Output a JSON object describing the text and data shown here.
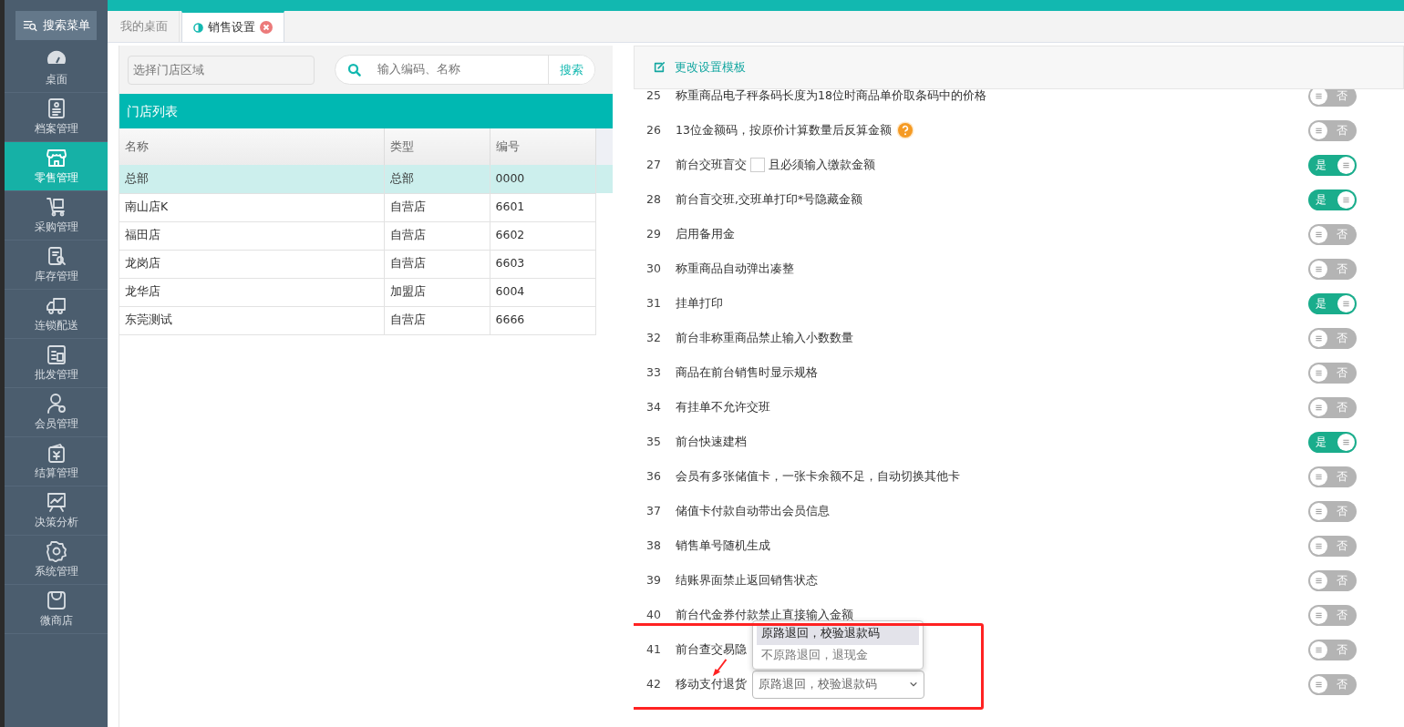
{
  "sidebar": {
    "search_button": "搜索菜单",
    "items": [
      {
        "label": "桌面",
        "kind": "gauge",
        "selected": false
      },
      {
        "label": "档案管理",
        "kind": "document",
        "selected": false
      },
      {
        "label": "零售管理",
        "kind": "store",
        "selected": true
      },
      {
        "label": "采购管理",
        "kind": "cart",
        "selected": false
      },
      {
        "label": "库存管理",
        "kind": "search-doc",
        "selected": false
      },
      {
        "label": "连锁配送",
        "kind": "truck",
        "selected": false
      },
      {
        "label": "批发管理",
        "kind": "clipboard",
        "selected": false
      },
      {
        "label": "会员管理",
        "kind": "user",
        "selected": false
      },
      {
        "label": "结算管理",
        "kind": "wallet",
        "selected": false
      },
      {
        "label": "决策分析",
        "kind": "chart",
        "selected": false
      },
      {
        "label": "系统管理",
        "kind": "gear",
        "selected": false
      },
      {
        "label": "微商店",
        "kind": "bag",
        "selected": false
      }
    ]
  },
  "tabs": [
    {
      "label": "我的桌面",
      "selected": false,
      "closable": false
    },
    {
      "label": "销售设置",
      "selected": true,
      "closable": true
    }
  ],
  "store_panel": {
    "region_placeholder": "选择门店区域",
    "search_placeholder": "输入编码、名称",
    "search_button": "搜索",
    "title": "门店列表",
    "table": {
      "columns": [
        "名称",
        "类型",
        "编号"
      ],
      "rows": [
        {
          "cells": [
            "总部",
            "总部",
            "0000"
          ],
          "selected": true
        },
        {
          "cells": [
            "南山店K",
            "自营店",
            "6601"
          ],
          "selected": false
        },
        {
          "cells": [
            "福田店",
            "自营店",
            "6602"
          ],
          "selected": false
        },
        {
          "cells": [
            "龙岗店",
            "自营店",
            "6603"
          ],
          "selected": false
        },
        {
          "cells": [
            "龙华店",
            "加盟店",
            "6004"
          ],
          "selected": false
        },
        {
          "cells": [
            "东莞测试",
            "自营店",
            "6666"
          ],
          "selected": false
        }
      ]
    }
  },
  "settings": {
    "template_link": "更改设置模板",
    "rows": [
      {
        "number": "25",
        "label": "称重商品电子秤条码长度为18位时商品单价取条码中的价格",
        "on": false,
        "toggle_label": "否"
      },
      {
        "number": "26",
        "label": "13位金额码，按原价计算数量后反算金额",
        "help": true,
        "on": false,
        "toggle_label": "否"
      },
      {
        "number": "27",
        "label": "前台交班盲交",
        "checkbox": {
          "label": "且必须输入缴款金额",
          "checked": false
        },
        "on": true,
        "toggle_label": "是"
      },
      {
        "number": "28",
        "label": "前台盲交班,交班单打印*号隐藏金额",
        "on": true,
        "toggle_label": "是"
      },
      {
        "number": "29",
        "label": "启用备用金",
        "on": false,
        "toggle_label": "否"
      },
      {
        "number": "30",
        "label": "称重商品自动弹出凑整",
        "on": false,
        "toggle_label": "否"
      },
      {
        "number": "31",
        "label": "挂单打印",
        "on": true,
        "toggle_label": "是"
      },
      {
        "number": "32",
        "label": "前台非称重商品禁止输入小数数量",
        "on": false,
        "toggle_label": "否"
      },
      {
        "number": "33",
        "label": "商品在前台销售时显示规格",
        "on": false,
        "toggle_label": "否"
      },
      {
        "number": "34",
        "label": "有挂单不允许交班",
        "on": false,
        "toggle_label": "否"
      },
      {
        "number": "35",
        "label": "前台快速建档",
        "on": true,
        "toggle_label": "是"
      },
      {
        "number": "36",
        "label": "会员有多张储值卡，一张卡余额不足，自动切换其他卡",
        "on": false,
        "toggle_label": "否"
      },
      {
        "number": "37",
        "label": "储值卡付款自动带出会员信息",
        "on": false,
        "toggle_label": "否"
      },
      {
        "number": "38",
        "label": "销售单号随机生成",
        "on": false,
        "toggle_label": "否"
      },
      {
        "number": "39",
        "label": "结账界面禁止返回销售状态",
        "on": false,
        "toggle_label": "否"
      },
      {
        "number": "40",
        "label": "前台代金券付款禁止直接输入金额",
        "on": false,
        "toggle_label": "否"
      },
      {
        "number": "41",
        "label": "前台查交易隐",
        "on": false,
        "toggle_label": "否"
      },
      {
        "number": "42",
        "label": "移动支付退货",
        "select": {
          "value": "原路退回，校验退款码",
          "expanded": true,
          "options": [
            {
              "label": "原路退回，校验退款码",
              "selected": true
            },
            {
              "label": "不原路退回，退现金",
              "selected": false
            }
          ]
        },
        "on": false,
        "toggle_label": "否"
      }
    ]
  }
}
